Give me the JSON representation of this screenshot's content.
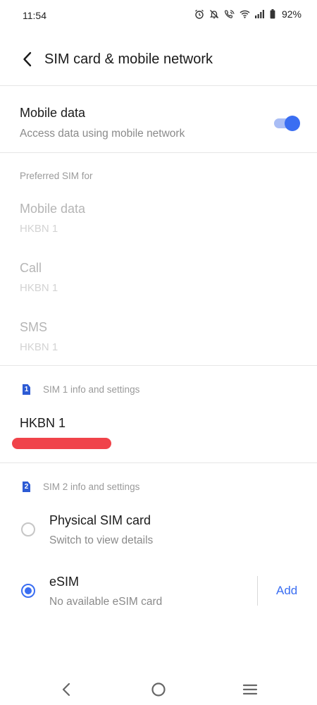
{
  "status_bar": {
    "time": "11:54",
    "battery": "92%",
    "icons": [
      "alarm-icon",
      "mute-icon",
      "wifi-calling-icon",
      "wifi-icon",
      "signal-icon",
      "battery-icon"
    ]
  },
  "header": {
    "title": "SIM card & mobile network"
  },
  "mobile_data": {
    "title": "Mobile data",
    "subtitle": "Access data using mobile network",
    "enabled": true
  },
  "preferred_sim": {
    "label": "Preferred SIM for",
    "items": [
      {
        "title": "Mobile data",
        "value": "HKBN 1"
      },
      {
        "title": "Call",
        "value": "HKBN 1"
      },
      {
        "title": "SMS",
        "value": "HKBN 1"
      }
    ]
  },
  "sim1": {
    "badge": "1",
    "label": "SIM 1 info and settings",
    "name": "HKBN 1"
  },
  "sim2": {
    "badge": "2",
    "label": "SIM 2 info and settings",
    "options": [
      {
        "title": "Physical SIM card",
        "subtitle": "Switch to view details",
        "selected": false
      },
      {
        "title": "eSIM",
        "subtitle": "No available eSIM card",
        "selected": true
      }
    ],
    "add_label": "Add"
  },
  "colors": {
    "accent": "#3a6ef2",
    "redaction": "#f0434a"
  }
}
